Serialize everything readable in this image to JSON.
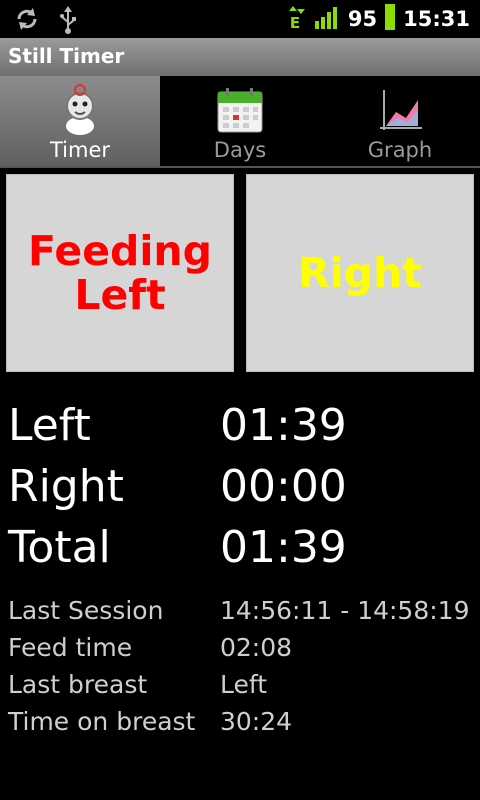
{
  "status_bar": {
    "battery_level": "95",
    "time": "15:31",
    "network_type": "E",
    "icons": [
      "sync-icon",
      "usb-icon",
      "data-arrows-icon",
      "signal-icon",
      "battery-icon"
    ]
  },
  "app": {
    "title": "Still Timer"
  },
  "tabs": [
    {
      "label": "Timer",
      "icon": "baby-icon",
      "active": true
    },
    {
      "label": "Days",
      "icon": "calendar-icon",
      "active": false
    },
    {
      "label": "Graph",
      "icon": "graph-icon",
      "active": false
    }
  ],
  "buttons": {
    "left": {
      "label": "Feeding\nLeft",
      "color": "#ff0000"
    },
    "right": {
      "label": "Right",
      "color": "#ffff00"
    }
  },
  "stats": [
    {
      "label": "Left",
      "value": "01:39"
    },
    {
      "label": "Right",
      "value": "00:00"
    },
    {
      "label": "Total",
      "value": "01:39"
    }
  ],
  "details": [
    {
      "label": "Last Session",
      "value": "14:56:11 - 14:58:19"
    },
    {
      "label": "Feed time",
      "value": "02:08"
    },
    {
      "label": "Last breast",
      "value": "Left"
    },
    {
      "label": "Time on breast",
      "value": "30:24"
    }
  ]
}
